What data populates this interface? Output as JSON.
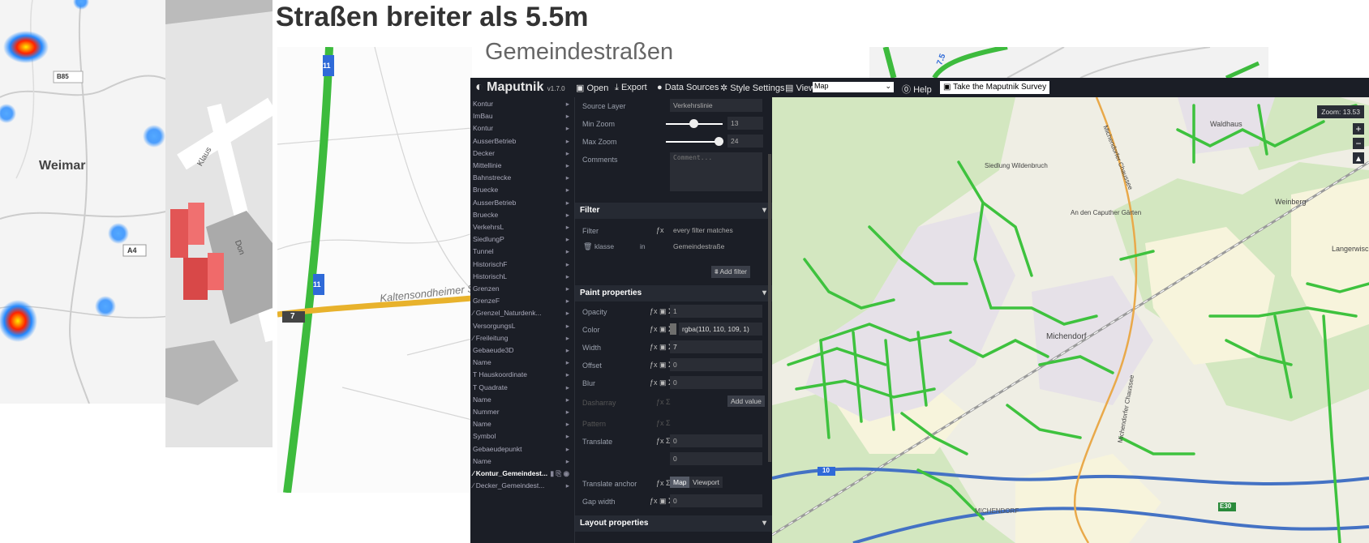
{
  "collage": {
    "title_main": "Straßen breiter als 5.5m",
    "title_sub": "Gemeindestraßen"
  },
  "panel_heatmap": {
    "labels": [
      "B85",
      "Weimar",
      "A4"
    ]
  },
  "panel_3d": {
    "street_labels": [
      "Klaus",
      "Don"
    ]
  },
  "panel_roads": {
    "road_numbers": [
      "11",
      "11",
      "7"
    ],
    "place_label": "Kaltensondheimer Str"
  },
  "panel_strip": {
    "road_number": "7.5"
  },
  "app": {
    "name": "Maputnik",
    "version": "v1.7.0",
    "toolbar": {
      "open": "Open",
      "export": "Export",
      "data_sources": "Data Sources",
      "style_settings": "Style Settings",
      "view": "View",
      "view_value": "Map",
      "help": "Help",
      "survey": "Take the Maputnik Survey"
    },
    "layers": [
      "Kontur",
      "ImBau",
      "Kontur",
      "AusserBetrieb",
      "Decker",
      "Mittellinie",
      "Bahnstrecke",
      "Bruecke",
      "AusserBetrieb",
      "Bruecke",
      "VerkehrsL",
      "SiedlungP",
      "Tunnel",
      "HistorischF",
      "HistorischL",
      "Grenzen",
      "GrenzeF",
      "Grenzel_Naturdenk...",
      "VersorgungsL",
      "Freileitung",
      "Gebaeude3D",
      "Name",
      "Hauskoordinate",
      "Quadrate",
      "Name",
      "Nummer",
      "Name",
      "Symbol",
      "Gebaeudepunkt",
      "Name",
      "Kontur_Gemeindest...",
      "Decker_Gemeindest..."
    ],
    "editor": {
      "source_layer_label": "Source Layer",
      "source_layer_value": "Verkehrslinie",
      "min_zoom_label": "Min Zoom",
      "min_zoom_value": "13",
      "max_zoom_label": "Max Zoom",
      "max_zoom_value": "24",
      "comments_label": "Comments",
      "comments_placeholder": "Comment...",
      "filter_section": "Filter",
      "filter_label": "Filter",
      "filter_mode": "every filter matches",
      "filter_field": "klasse",
      "filter_op": "in",
      "filter_value": "Gemeindestraße",
      "add_filter": "Add filter",
      "paint_section": "Paint properties",
      "opacity_label": "Opacity",
      "opacity_value": "1",
      "color_label": "Color",
      "color_value": "rgba(110, 110, 109, 1)",
      "color_swatch": "#6e6e6d",
      "width_label": "Width",
      "width_value": "7",
      "offset_label": "Offset",
      "offset_value": "0",
      "blur_label": "Blur",
      "blur_value": "0",
      "dasharray_label": "Dasharray",
      "add_value": "Add value",
      "pattern_label": "Pattern",
      "translate_label": "Translate",
      "translate_x": "0",
      "translate_y": "0",
      "translate_anchor_label": "Translate anchor",
      "anchor_map": "Map",
      "anchor_viewport": "Viewport",
      "gap_width_label": "Gap width",
      "gap_width_value": "0",
      "layout_section": "Layout properties"
    },
    "map": {
      "zoom_text": "Zoom: 13.53",
      "labels": [
        "Waldhaus",
        "Weinberg",
        "Langerwisch",
        "Siedlung Wildenbruch",
        "An den Caputher Gärten",
        "Michendorf",
        "Michendorfer Chaussee",
        "MICHENDORF",
        "Michendorfer Chaussee"
      ],
      "road_shields": [
        "10",
        "E30"
      ],
      "road_color": "#3ec23e"
    }
  }
}
